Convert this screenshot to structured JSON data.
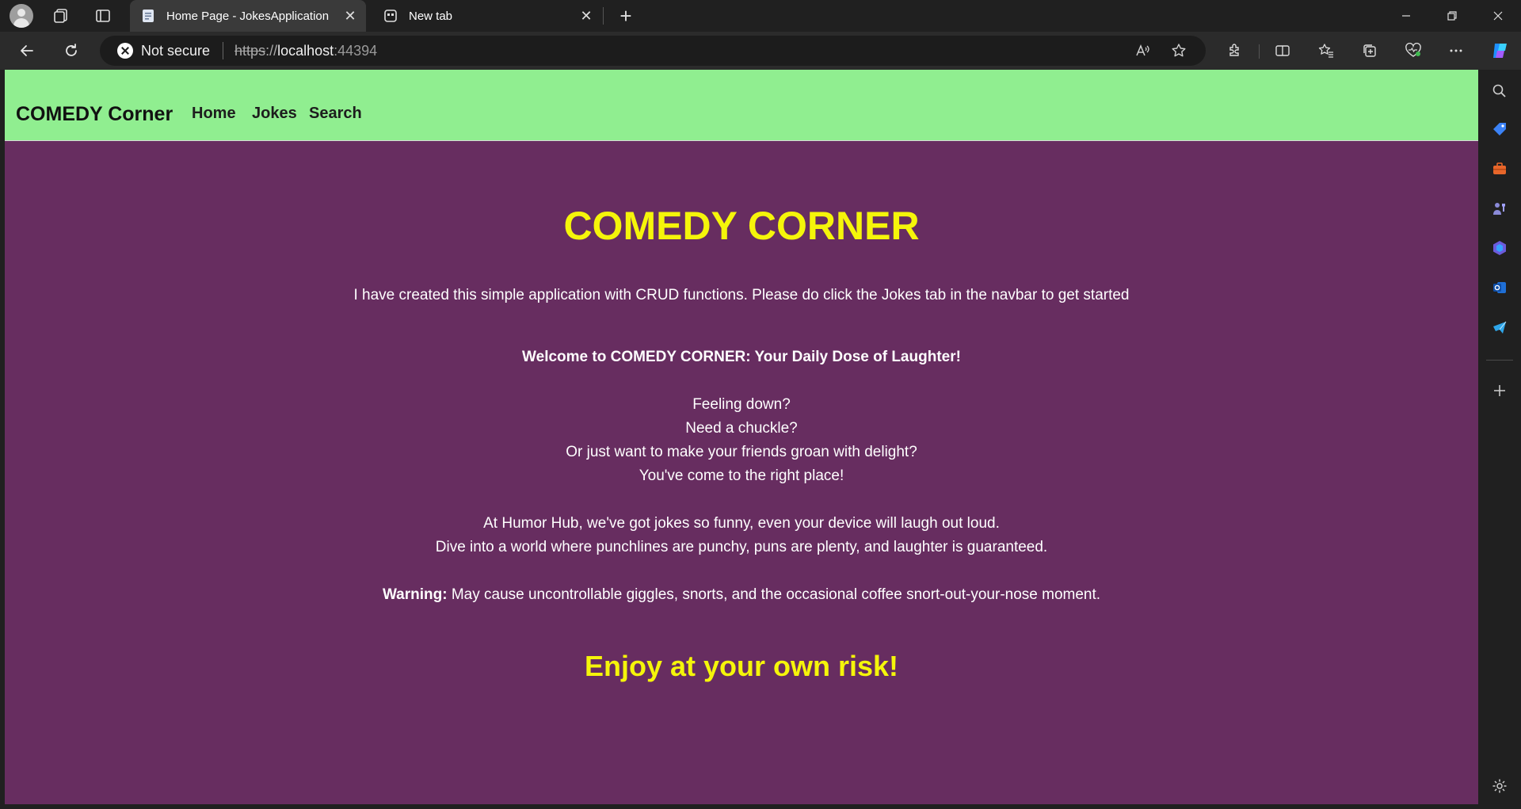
{
  "browser": {
    "tabs": [
      {
        "title": "Home Page - JokesApplication",
        "active": true
      },
      {
        "title": "New tab",
        "active": false
      }
    ],
    "address": {
      "security_label": "Not secure",
      "scheme": "https",
      "scheme_separator": "://",
      "host": "localhost",
      "port": ":44394"
    }
  },
  "site": {
    "brand": "COMEDY Corner",
    "nav": [
      "Home",
      "Jokes",
      "Search"
    ],
    "nav_bg": "#90ee90",
    "page_bg": "#672d60",
    "accent": "#f5f50a"
  },
  "content": {
    "title": "COMEDY CORNER",
    "intro": "I have created this simple application with CRUD functions. Please do click the Jokes tab in the navbar to get started",
    "welcome": "Welcome to COMEDY CORNER: Your Daily Dose of Laughter!",
    "lines1": [
      "Feeling down?",
      "Need a chuckle?",
      "Or just want to make your friends groan with delight?",
      "You've come to the right place!"
    ],
    "lines2": [
      "At Humor Hub, we've got jokes so funny, even your device will laugh out loud.",
      "Dive into a world where punchlines are punchy, puns are plenty, and laughter is guaranteed."
    ],
    "warning_label": "Warning:",
    "warning_text": " May cause uncontrollable giggles, snorts, and the occasional coffee snort-out-your-nose moment.",
    "closing": "Enjoy at your own risk!"
  }
}
